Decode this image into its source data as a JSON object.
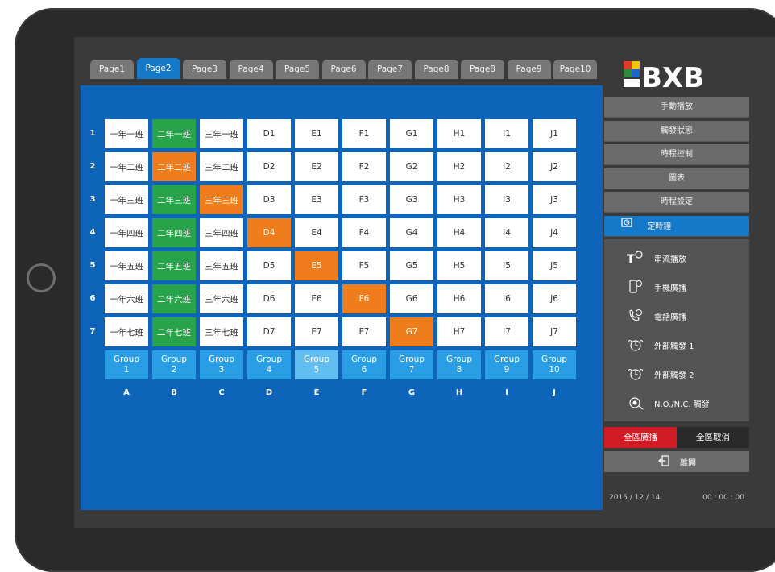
{
  "tabs": [
    "Page1",
    "Page2",
    "Page3",
    "Page4",
    "Page5",
    "Page6",
    "Page7",
    "Page8",
    "Page8",
    "Page9",
    "Page10"
  ],
  "active_tab_index": 1,
  "logo_text": "BXB",
  "grid": {
    "row_numbers": [
      "1",
      "2",
      "3",
      "4",
      "5",
      "6",
      "7"
    ],
    "rows": [
      [
        "一年一班",
        "二年一班",
        "三年一班",
        "D1",
        "E1",
        "F1",
        "G1",
        "H1",
        "I1",
        "J1"
      ],
      [
        "一年二班",
        "二年二班",
        "三年二班",
        "D2",
        "E2",
        "F2",
        "G2",
        "H2",
        "I2",
        "J2"
      ],
      [
        "一年三班",
        "二年三班",
        "三年三班",
        "D3",
        "E3",
        "F3",
        "G3",
        "H3",
        "I3",
        "J3"
      ],
      [
        "一年四班",
        "二年四班",
        "三年四班",
        "D4",
        "E4",
        "F4",
        "G4",
        "H4",
        "I4",
        "J4"
      ],
      [
        "一年五班",
        "二年五班",
        "三年五班",
        "D5",
        "E5",
        "F5",
        "G5",
        "H5",
        "I5",
        "J5"
      ],
      [
        "一年六班",
        "二年六班",
        "三年六班",
        "D6",
        "E6",
        "F6",
        "G6",
        "H6",
        "I6",
        "J6"
      ],
      [
        "一年七班",
        "二年七班",
        "三年七班",
        "D7",
        "E7",
        "F7",
        "G7",
        "H7",
        "I7",
        "J7"
      ]
    ],
    "cell_states": [
      [
        "white",
        "green",
        "white",
        "white",
        "white",
        "white",
        "white",
        "white",
        "white",
        "white"
      ],
      [
        "white",
        "orange",
        "white",
        "white",
        "white",
        "white",
        "white",
        "white",
        "white",
        "white"
      ],
      [
        "white",
        "green",
        "orange",
        "white",
        "white",
        "white",
        "white",
        "white",
        "white",
        "white"
      ],
      [
        "white",
        "green",
        "white",
        "orange",
        "white",
        "white",
        "white",
        "white",
        "white",
        "white"
      ],
      [
        "white",
        "green",
        "white",
        "white",
        "orange",
        "white",
        "white",
        "white",
        "white",
        "white"
      ],
      [
        "white",
        "green",
        "white",
        "white",
        "white",
        "orange",
        "white",
        "white",
        "white",
        "white"
      ],
      [
        "white",
        "green",
        "white",
        "white",
        "white",
        "white",
        "orange",
        "white",
        "white",
        "white"
      ]
    ],
    "groups": [
      {
        "label": "Group",
        "num": "1"
      },
      {
        "label": "Group",
        "num": "2"
      },
      {
        "label": "Group",
        "num": "3"
      },
      {
        "label": "Group",
        "num": "4"
      },
      {
        "label": "Group",
        "num": "5"
      },
      {
        "label": "Group",
        "num": "6"
      },
      {
        "label": "Group",
        "num": "7"
      },
      {
        "label": "Group",
        "num": "8"
      },
      {
        "label": "Group",
        "num": "9"
      },
      {
        "label": "Group",
        "num": "10"
      }
    ],
    "highlight_group_index": 4,
    "column_letters": [
      "A",
      "B",
      "C",
      "D",
      "E",
      "F",
      "G",
      "H",
      "I",
      "J"
    ]
  },
  "menu": [
    "手動播放",
    "觸發狀態",
    "時程控制",
    "圖表",
    "時程設定"
  ],
  "menu_active": "定時鐘",
  "sub_items": [
    {
      "label": "串流播放",
      "icon": "stream-icon"
    },
    {
      "label": "手機廣播",
      "icon": "phone-broadcast-icon"
    },
    {
      "label": "電話廣播",
      "icon": "telephone-icon"
    },
    {
      "label": "外部觸發 1",
      "icon": "timer-trigger-icon"
    },
    {
      "label": "外部觸發 2",
      "icon": "timer-trigger-icon"
    },
    {
      "label": "N.O./N.C. 觸發",
      "icon": "switch-icon"
    }
  ],
  "all_broadcast": "全區廣播",
  "all_cancel": "全區取消",
  "exit": "離開",
  "status": {
    "date": "2015 / 12 / 14",
    "time": "00 : 00 : 00"
  },
  "colors": {
    "blue": "#0e64b8",
    "green": "#27a34a",
    "orange": "#ef7d1c",
    "red": "#d11b24"
  }
}
